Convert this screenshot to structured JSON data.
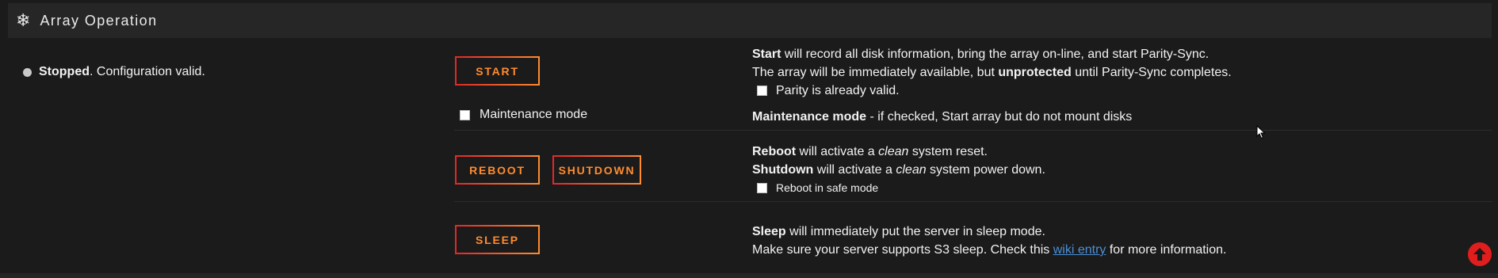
{
  "header": {
    "icon": "snowflake-icon",
    "title": "Array Operation"
  },
  "status": {
    "state": "Stopped",
    "message": ". Configuration valid."
  },
  "buttons": {
    "start": "Start",
    "reboot": "Reboot",
    "shutdown": "Shutdown",
    "sleep": "Sleep"
  },
  "maintenance": {
    "label": "Maintenance mode",
    "checked": false
  },
  "start_desc": {
    "line1_bold": "Start",
    "line1_rest": " will record all disk information, bring the array on-line, and start Parity-Sync.",
    "line2_pre": "The array will be immediately available, but ",
    "line2_bold": "unprotected",
    "line2_post": " until Parity-Sync completes.",
    "parity_label": "Parity is already valid."
  },
  "maint_desc": {
    "bold": "Maintenance mode",
    "rest": " - if checked, Start array but do not mount disks"
  },
  "reboot_desc": {
    "reboot_bold": "Reboot",
    "reboot_pre": " will activate a ",
    "reboot_em": "clean",
    "reboot_post": " system reset.",
    "shutdown_bold": "Shutdown",
    "shutdown_pre": " will activate a ",
    "shutdown_em": "clean",
    "shutdown_post": " system power down.",
    "safe_label": "Reboot in safe mode"
  },
  "sleep_desc": {
    "bold": "Sleep",
    "rest": " will immediately put the server in sleep mode.",
    "line2_pre": "Make sure your server supports S3 sleep. Check this ",
    "link": "wiki entry",
    "line2_post": " for more information."
  },
  "colors": {
    "accent_start": "#e22828",
    "accent_end": "#ff8c2f",
    "link": "#4a8fd6",
    "back_to_top": "#e21d1d"
  }
}
